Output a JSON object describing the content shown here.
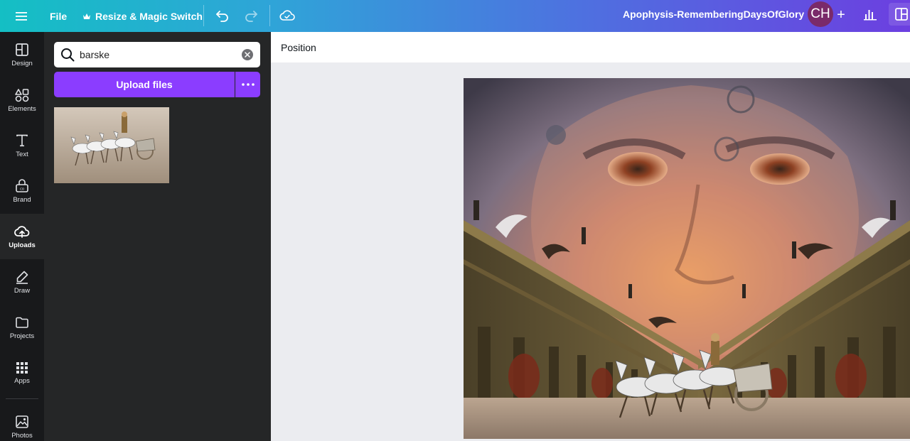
{
  "topbar": {
    "file_label": "File",
    "resize_label": "Resize & Magic Switch",
    "doc_title": "Apophysis-RememberingDaysOfGlory",
    "avatar_initials": "CH",
    "plus_label": "+"
  },
  "sidebar": {
    "items": [
      {
        "label": "Design",
        "icon": "layout-icon"
      },
      {
        "label": "Elements",
        "icon": "shapes-icon"
      },
      {
        "label": "Text",
        "icon": "text-icon"
      },
      {
        "label": "Brand",
        "icon": "brand-icon"
      },
      {
        "label": "Uploads",
        "icon": "cloud-upload-icon",
        "active": true
      },
      {
        "label": "Draw",
        "icon": "pen-icon"
      },
      {
        "label": "Projects",
        "icon": "folder-icon"
      },
      {
        "label": "Apps",
        "icon": "grid-icon"
      },
      {
        "label": "Photos",
        "icon": "photo-icon"
      }
    ]
  },
  "uploads": {
    "search_value": "barske",
    "upload_label": "Upload files"
  },
  "context_bar": {
    "position_label": "Position"
  },
  "colors": {
    "accent": "#8b3dff",
    "topbar_start": "#14bfc4",
    "topbar_end": "#6c3fe0",
    "sidebar_bg": "#18191b",
    "panel_bg": "#252627"
  }
}
